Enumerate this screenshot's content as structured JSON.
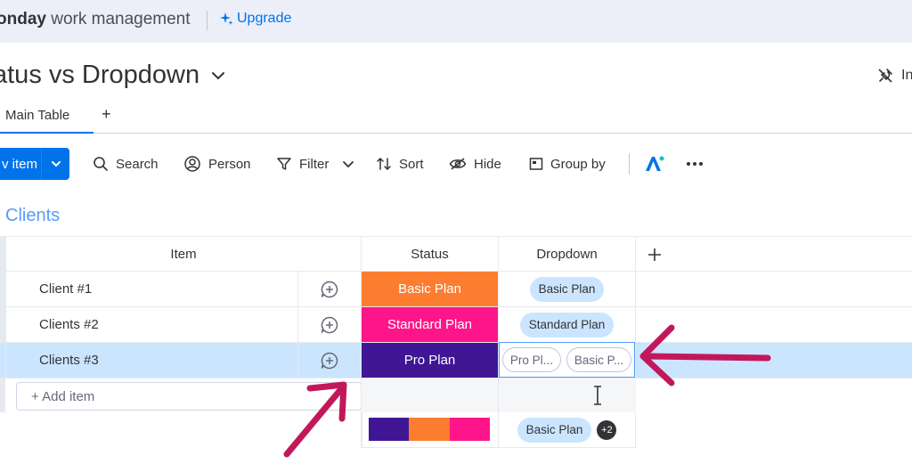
{
  "topbar": {
    "brand_bold": "onday",
    "brand_rest": " work management",
    "upgrade_label": "Upgrade"
  },
  "board": {
    "title": "atus vs Dropdown",
    "integrate_label": "In"
  },
  "tabs": {
    "main_label": "Main Table",
    "add_label": "+"
  },
  "toolbar": {
    "new_item_label": "v item",
    "search_label": "Search",
    "person_label": "Person",
    "filter_label": "Filter",
    "sort_label": "Sort",
    "hide_label": "Hide",
    "group_by_label": "Group by"
  },
  "group": {
    "title": "Clients",
    "columns": {
      "item": "Item",
      "status": "Status",
      "dropdown": "Dropdown",
      "add": "+"
    },
    "rows": [
      {
        "name": "Client #1",
        "status": "Basic Plan",
        "status_color": "#fd7d30",
        "dropdown": [
          "Basic Plan"
        ]
      },
      {
        "name": "Clients #2",
        "status": "Standard Plan",
        "status_color": "#ff158a",
        "dropdown": [
          "Standard Plan"
        ]
      },
      {
        "name": "Clients #3",
        "status": "Pro Plan",
        "status_color": "#401694",
        "dropdown": [
          "Pro Pl...",
          "Basic P..."
        ]
      }
    ],
    "add_item_label": "+ Add item",
    "summary": {
      "status_colors": [
        "#401694",
        "#fd7d30",
        "#ff158a"
      ],
      "dropdown_label": "Basic Plan",
      "dropdown_more": "+2"
    }
  },
  "colors": {
    "accent": "#0073ea",
    "arrow": "#c2185b",
    "selected_row": "#cce5ff"
  }
}
